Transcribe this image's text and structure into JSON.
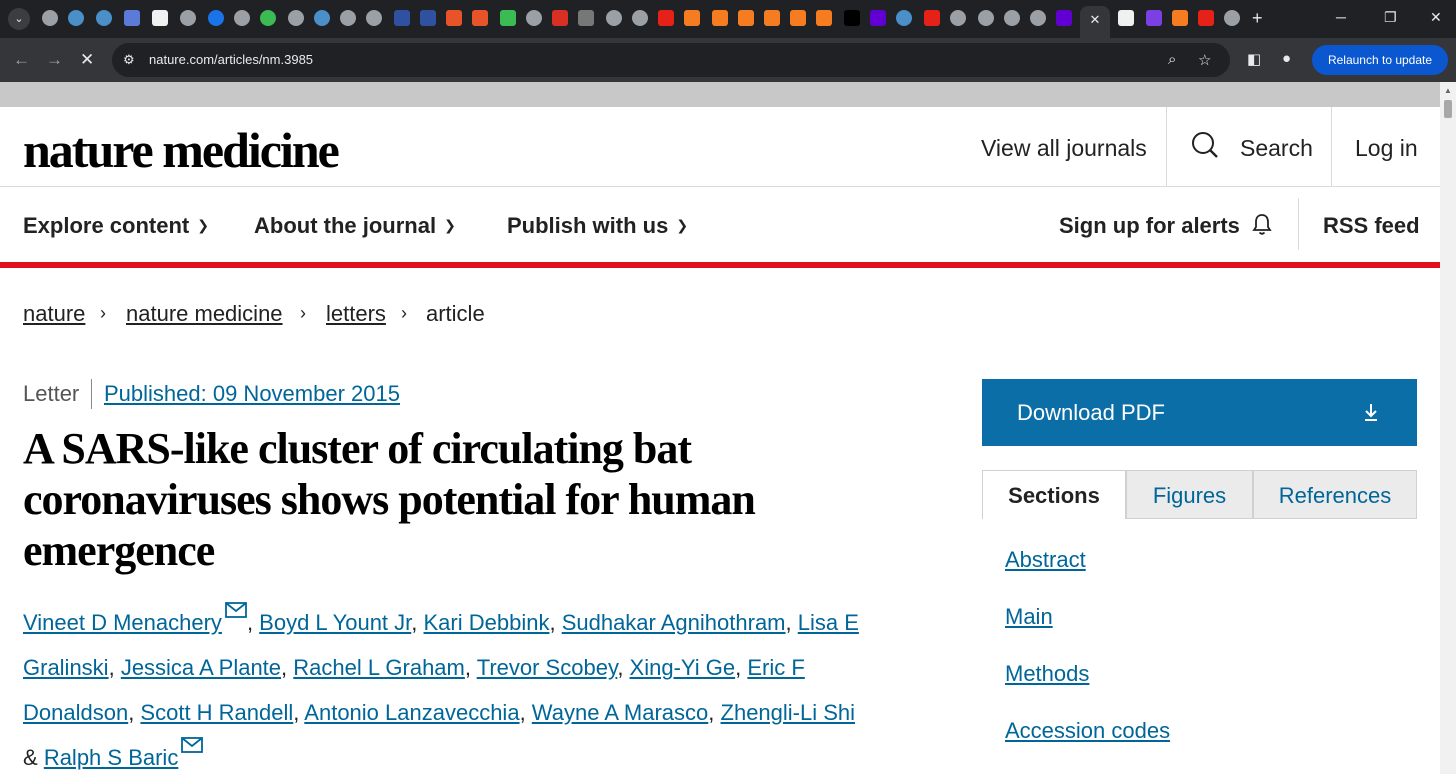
{
  "browser": {
    "url": "nature.com/articles/nm.3985",
    "relaunch_label": "Relaunch to update",
    "active_tab_close": "✕",
    "new_tab": "+"
  },
  "site": {
    "logo": "nature medicine",
    "header_links": {
      "view_all": "View all journals",
      "search": "Search",
      "login": "Log in"
    },
    "menu": {
      "explore": "Explore content",
      "about": "About the journal",
      "publish": "Publish with us",
      "alerts": "Sign up for alerts",
      "rss": "RSS feed"
    }
  },
  "breadcrumb": [
    "nature",
    "nature medicine",
    "letters",
    "article"
  ],
  "article": {
    "type": "Letter",
    "published": "Published: 09 November 2015",
    "title": "A SARS-like cluster of circulating bat coronaviruses shows potential for human emergence",
    "authors": [
      "Vineet D Menachery",
      "Boyd L Yount Jr",
      "Kari Debbink",
      "Sudhakar Agnihothram",
      "Lisa E Gralinski",
      "Jessica A Plante",
      "Rachel L Graham",
      "Trevor Scobey",
      "Xing-Yi Ge",
      "Eric F Donaldson",
      "Scott H Randell",
      "Antonio Lanzavecchia",
      "Wayne A Marasco",
      "Zhengli-Li Shi",
      "Ralph S Baric"
    ],
    "ampersand": "&"
  },
  "sidebar": {
    "download": "Download PDF",
    "tabs": [
      "Sections",
      "Figures",
      "References"
    ],
    "sections": [
      "Abstract",
      "Main",
      "Methods",
      "Accession codes"
    ]
  },
  "colors": {
    "accent_red": "#e0101c",
    "link_blue": "#006699",
    "download_blue": "#0c6ea6"
  }
}
